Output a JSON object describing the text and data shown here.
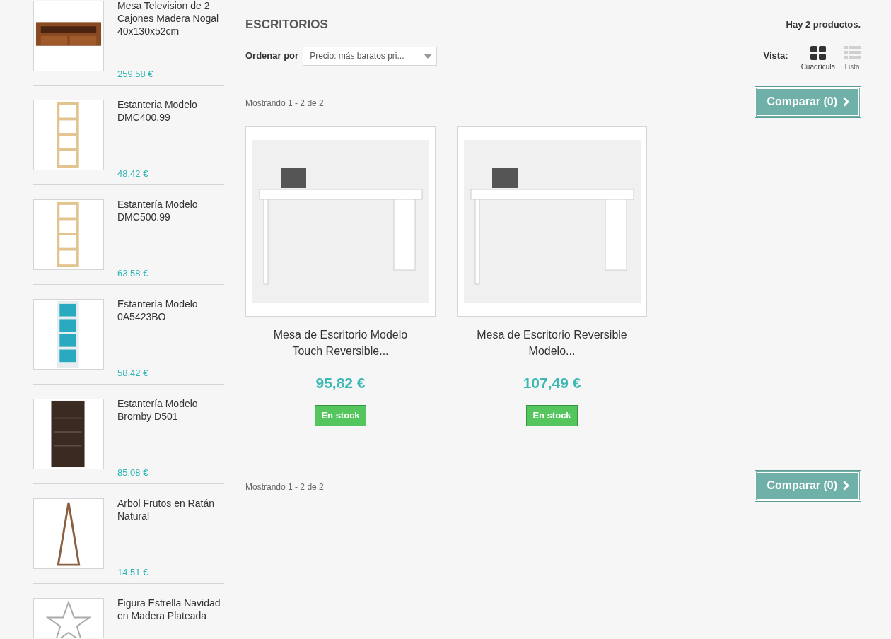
{
  "sidebar": {
    "items": [
      {
        "name": "Mesa Television de 2 Cajones Madera Nogal 40x130x52cm",
        "price": "259,58 €",
        "kind": "tv-stand"
      },
      {
        "name": "Estanteria Modelo DMC400.99",
        "price": "48,42 €",
        "kind": "shelf"
      },
      {
        "name": "Estantería Modelo DMC500.99",
        "price": "63,58 €",
        "kind": "shelf"
      },
      {
        "name": "Estantería Modelo 0A5423BO",
        "price": "58,42 €",
        "kind": "teal-shelf"
      },
      {
        "name": "Estantería Modelo Bromby D501",
        "price": "85,08 €",
        "kind": "dark-shelf"
      },
      {
        "name": "Arbol Frutos en Ratán Natural",
        "price": "14,51 €",
        "kind": "tree"
      },
      {
        "name": "Figura Estrella Navidad en Madera Plateada",
        "kind": "star"
      }
    ]
  },
  "category": {
    "title": "ESCRITORIOS",
    "count": "Hay 2 productos."
  },
  "sort": {
    "label": "Ordenar por",
    "value": "Precio: más baratos pri..."
  },
  "view": {
    "label": "Vista:",
    "options": [
      {
        "label": "Cuadrícula",
        "kind": "grid",
        "selected": true
      },
      {
        "label": "Lista",
        "kind": "list",
        "selected": false
      }
    ]
  },
  "top_bar": {
    "showing": "Mostrando 1 - 2 de 2",
    "compare": "Comparar (0)"
  },
  "products": [
    {
      "name": "Mesa de Escritorio Modelo Touch Reversible...",
      "price": "95,82 €",
      "availability": "En stock"
    },
    {
      "name": "Mesa de Escritorio Reversible Modelo...",
      "price": "107,49 €",
      "availability": "En stock"
    }
  ],
  "bottom_bar": {
    "showing": "Mostrando 1 - 2 de 2",
    "compare": "Comparar (0)"
  }
}
